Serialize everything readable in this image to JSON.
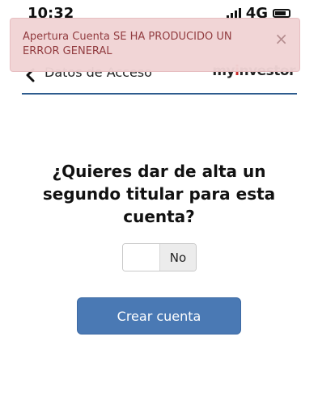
{
  "status_bar": {
    "time": "10:32",
    "network": "4G"
  },
  "header": {
    "title": "Datos de Acceso",
    "brand_prefix": "my",
    "brand_accent": "i",
    "brand_suffix": "nvestor"
  },
  "alert": {
    "message": "Apertura Cuenta SE HA PRODUCIDO UN ERROR GENERAL",
    "close_symbol": "×"
  },
  "question": {
    "text": "¿Quieres dar de alta un segundo titular para esta cuenta?"
  },
  "toggle": {
    "label": "No",
    "state": "off"
  },
  "actions": {
    "create_account": "Crear cuenta"
  },
  "colors": {
    "accent": "#4a79b4",
    "header_rule": "#2d5c8e",
    "alert_bg": "#f1d4d5",
    "alert_text": "#8e3539"
  }
}
